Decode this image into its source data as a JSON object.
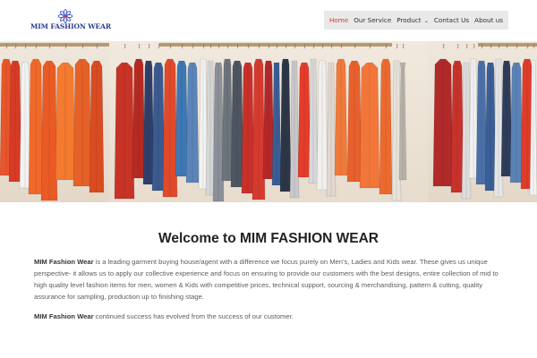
{
  "logo": {
    "text": "MIM FASHION WEAR",
    "icon": "flower-logo-icon"
  },
  "nav": {
    "items": [
      {
        "label": "Home",
        "active": true
      },
      {
        "label": "Our Service",
        "active": false
      },
      {
        "label": "Product",
        "active": false,
        "has_dropdown": true
      },
      {
        "label": "Contact Us",
        "active": false
      },
      {
        "label": "About us",
        "active": false
      }
    ],
    "caret": "⌄"
  },
  "hero": {
    "image": "clothes-rack-banner"
  },
  "main": {
    "title": "Welcome to MIM FASHION WEAR",
    "para1_brand": "MIM Fashion Wear",
    "para1_text": " is a leading garment buying house/agent with a difference we focus purely on Men’s, Ladies and Kids wear. These gives us unique perspective- it allows us to apply our collective experience and focus on ensuring to provide our customers with the best designs, entire collection of mid to high quality level fashion items for men, women & Kids with competitive prices, technical support, sourcing & merchandising, pattern & cutting, quality assurance for sampling, production up to finishing stage.",
    "para2_brand": "MIM Fashion Wear",
    "para2_text": " continued success has evolved from the success of our customer."
  },
  "colors": {
    "accent": "#e0352b",
    "nav_bg": "#e9e9e9",
    "logo_blue": "#2a3b8f"
  }
}
